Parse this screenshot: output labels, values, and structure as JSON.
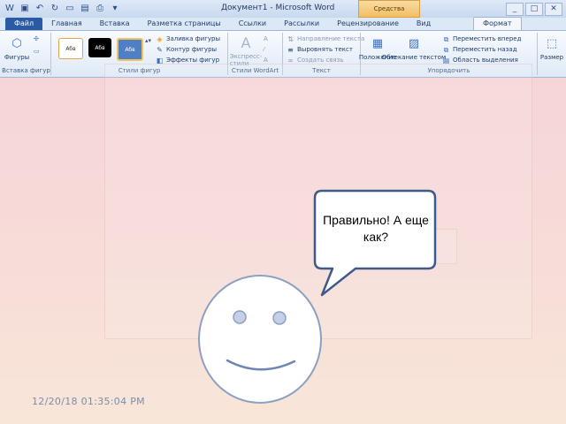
{
  "window": {
    "title": "Документ1 - Microsoft Word",
    "context_tab": "Средства рисования",
    "controls": [
      "_",
      "□",
      "✕"
    ]
  },
  "tabs": [
    {
      "label": "Файл"
    },
    {
      "label": "Главная"
    },
    {
      "label": "Вставка"
    },
    {
      "label": "Разметка страницы"
    },
    {
      "label": "Ссылки"
    },
    {
      "label": "Рассылки"
    },
    {
      "label": "Рецензирование"
    },
    {
      "label": "Вид"
    },
    {
      "label": "Формат"
    }
  ],
  "ribbon": {
    "insert_shapes": {
      "shapes_label": "Фигуры",
      "group_label": "Вставка фигур"
    },
    "shape_styles": {
      "swatches": [
        "Абв",
        "Абв",
        "Абв"
      ],
      "fill": "Заливка фигуры",
      "outline": "Контур фигуры",
      "effects": "Эффекты фигур",
      "group_label": "Стили фигур"
    },
    "wordart": {
      "express_styles": "Экспресс-стили",
      "group_label": "Стили WordArt"
    },
    "text": {
      "direction": "Направление текста",
      "align": "Выровнять текст",
      "link": "Создать связь",
      "group_label": "Текст"
    },
    "arrange": {
      "position": "Положение",
      "wrap": "Обтекание текстом",
      "forward": "Переместить вперед",
      "backward": "Переместить назад",
      "selection_pane": "Область выделения",
      "group_label": "Упорядочить"
    },
    "size": {
      "label": "Размер"
    }
  },
  "slide": {
    "speech_bubble_text": "Правильно! А еще как?",
    "timestamp": "12/20/18 01:35:04 PM"
  },
  "colors": {
    "accent": "#2a5aa4",
    "bubble_stroke": "#3f5a88",
    "face_fill": "#ffffff",
    "eye_fill": "#c5d0e6"
  }
}
